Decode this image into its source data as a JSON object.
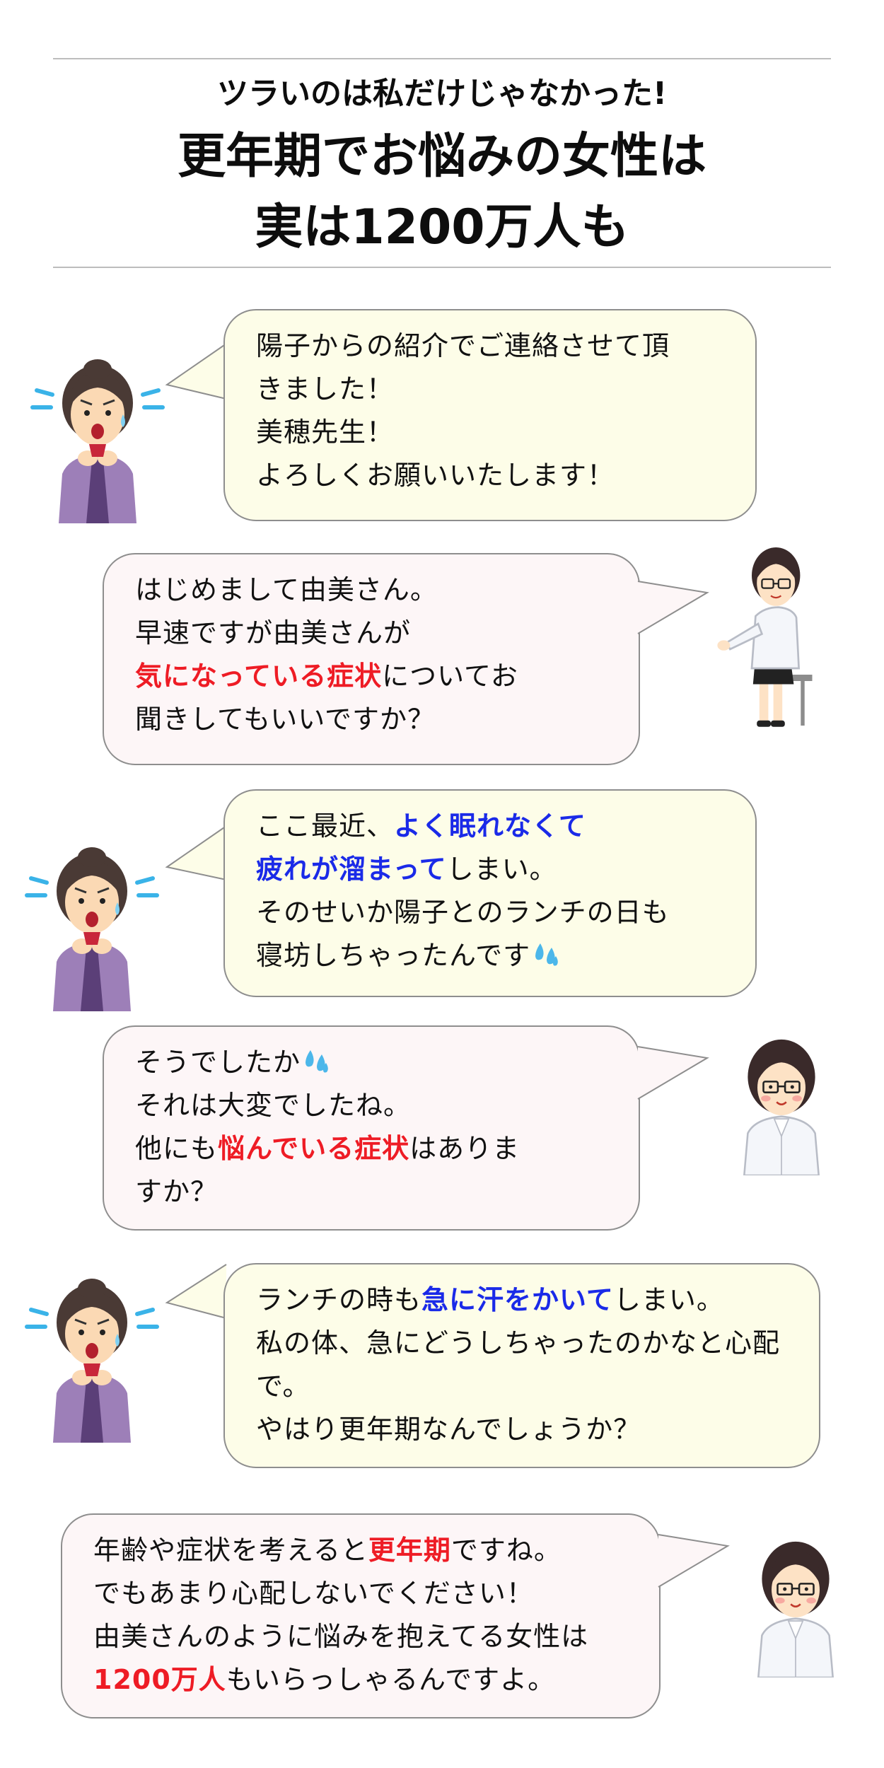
{
  "header": {
    "line1": "ツラいのは私だけじゃなかった!",
    "line2": "更年期でお悩みの女性は",
    "line3": "実は1200万人も"
  },
  "dialogue": [
    {
      "speaker": "patient",
      "lines": [
        "陽子からの紹介でご連絡させて頂",
        "きました！",
        "美穂先生！",
        "よろしくお願いいたします！"
      ]
    },
    {
      "speaker": "doctor",
      "line1": "はじめまして由美さん。",
      "line2": "早速ですが由美さんが",
      "line3_em": "気になっている症状",
      "line3_rest": "についてお",
      "line4": "聞きしてもいいですか？"
    },
    {
      "speaker": "patient",
      "line1_pre": "ここ最近、",
      "line1_em": "よく眠れなくて",
      "line2_em": "疲れが溜まって",
      "line2_rest": "しまい。",
      "line3": "そのせいか陽子とのランチの日も",
      "line4": "寝坊しちゃったんです"
    },
    {
      "speaker": "doctor",
      "line1": "そうでしたか",
      "line2": "それは大変でしたね。",
      "line3_pre": "他にも",
      "line3_em": "悩んでいる症状",
      "line3_rest": "はありま",
      "line4": "すか？"
    },
    {
      "speaker": "patient",
      "line1_pre": "ランチの時も",
      "line1_em": "急に汗をかいて",
      "line1_rest": "しまい。",
      "line2": "私の体、急にどうしちゃったのかなと心配",
      "line3": "で。",
      "line4": "やはり更年期なんでしょうか？"
    },
    {
      "speaker": "doctor",
      "line1_pre": "年齢や症状を考えると",
      "line1_em": "更年期",
      "line1_rest": "ですね。",
      "line2": "でもあまり心配しないでください！",
      "line3": "由美さんのように悩みを抱えてる女性は",
      "line4_em": "1200万人",
      "line4_rest": "もいらっしゃるんですよ。"
    }
  ],
  "colors": {
    "accent_red": "#ee1c25",
    "accent_blue": "#1a2ae8",
    "bubble_patient": "#fdfde8",
    "bubble_doctor": "#fdf6f7",
    "divider": "#bdbdbd"
  },
  "icons": {
    "patient": "worried-woman-illustration",
    "doctor": "female-doctor-illustration",
    "sweat": "sweat-drop-icon"
  }
}
